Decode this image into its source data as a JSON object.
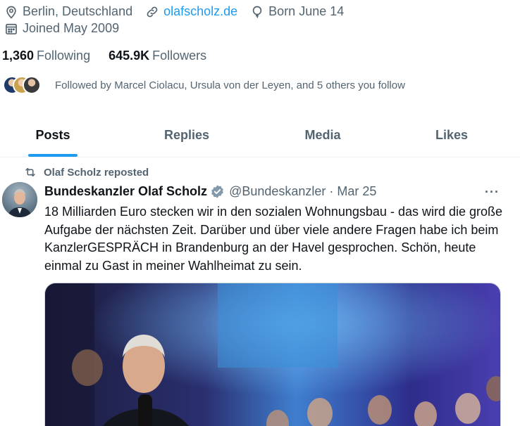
{
  "profile": {
    "location": "Berlin, Deutschland",
    "website": "olafscholz.de",
    "born": "Born June 14",
    "joined": "Joined May 2009",
    "following_count": "1,360",
    "following_label": "Following",
    "followers_count": "645.9K",
    "followers_label": "Followers",
    "followed_by": "Followed by Marcel Ciolacu, Ursula von der Leyen, and 5 others you follow"
  },
  "tabs": [
    {
      "label": "Posts",
      "active": true
    },
    {
      "label": "Replies",
      "active": false
    },
    {
      "label": "Media",
      "active": false
    },
    {
      "label": "Likes",
      "active": false
    }
  ],
  "tweet": {
    "reposted_by": "Olaf Scholz reposted",
    "author_name": "Bundeskanzler Olaf Scholz",
    "handle": "@Bundeskanzler",
    "separator": "·",
    "date": "Mar 25",
    "more": "···",
    "text": "18 Milliarden Euro stecken wir in den sozialen Wohnungsbau - das wird die große Aufgabe der nächsten Zeit. Darüber und über viele andere Fragen habe ich beim KanzlerGESPRÄCH in Brandenburg an der Havel gesprochen. Schön, heute einmal zu Gast in meiner Wahlheimat zu sein."
  },
  "colors": {
    "accent": "#1d9bf0",
    "secondary_text": "#536471",
    "primary_text": "#0f1419"
  },
  "icons": {
    "location": "location-pin-icon",
    "link": "link-icon",
    "birthday": "balloon-icon",
    "joined": "calendar-icon",
    "repost": "repost-icon",
    "verified": "verified-badge-icon",
    "more": "more-icon"
  }
}
